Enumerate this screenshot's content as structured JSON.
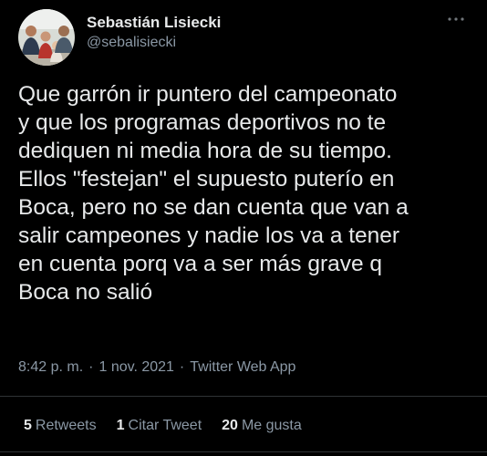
{
  "author": {
    "display_name": "Sebastián Lisiecki",
    "handle": "@sebalisiecki",
    "avatar_icon": "profile-photo"
  },
  "more_icon": "more-options-icon",
  "tweet": {
    "lines": [
      "Que garrón ir puntero del campeonato",
      "y que los programas deportivos no te",
      "dediquen ni media hora de su tiempo.",
      "Ellos \"festejan\" el supuesto puterío en",
      "Boca, pero no se dan cuenta que van a",
      "salir campeones y nadie los va a tener",
      "en cuenta porq va a ser más grave q",
      "Boca no salió"
    ]
  },
  "meta": {
    "time": "8:42 p. m.",
    "separator": "·",
    "date": "1 nov. 2021",
    "source": "Twitter Web App"
  },
  "stats": {
    "retweets_count": "5",
    "retweets_label": "Retweets",
    "quotes_count": "1",
    "quotes_label": "Citar Tweet",
    "likes_count": "20",
    "likes_label": "Me gusta"
  },
  "colors": {
    "background": "#000000",
    "primary_text": "#e7e9ea",
    "secondary_text": "#8b98a5",
    "divider": "#2f3336"
  }
}
